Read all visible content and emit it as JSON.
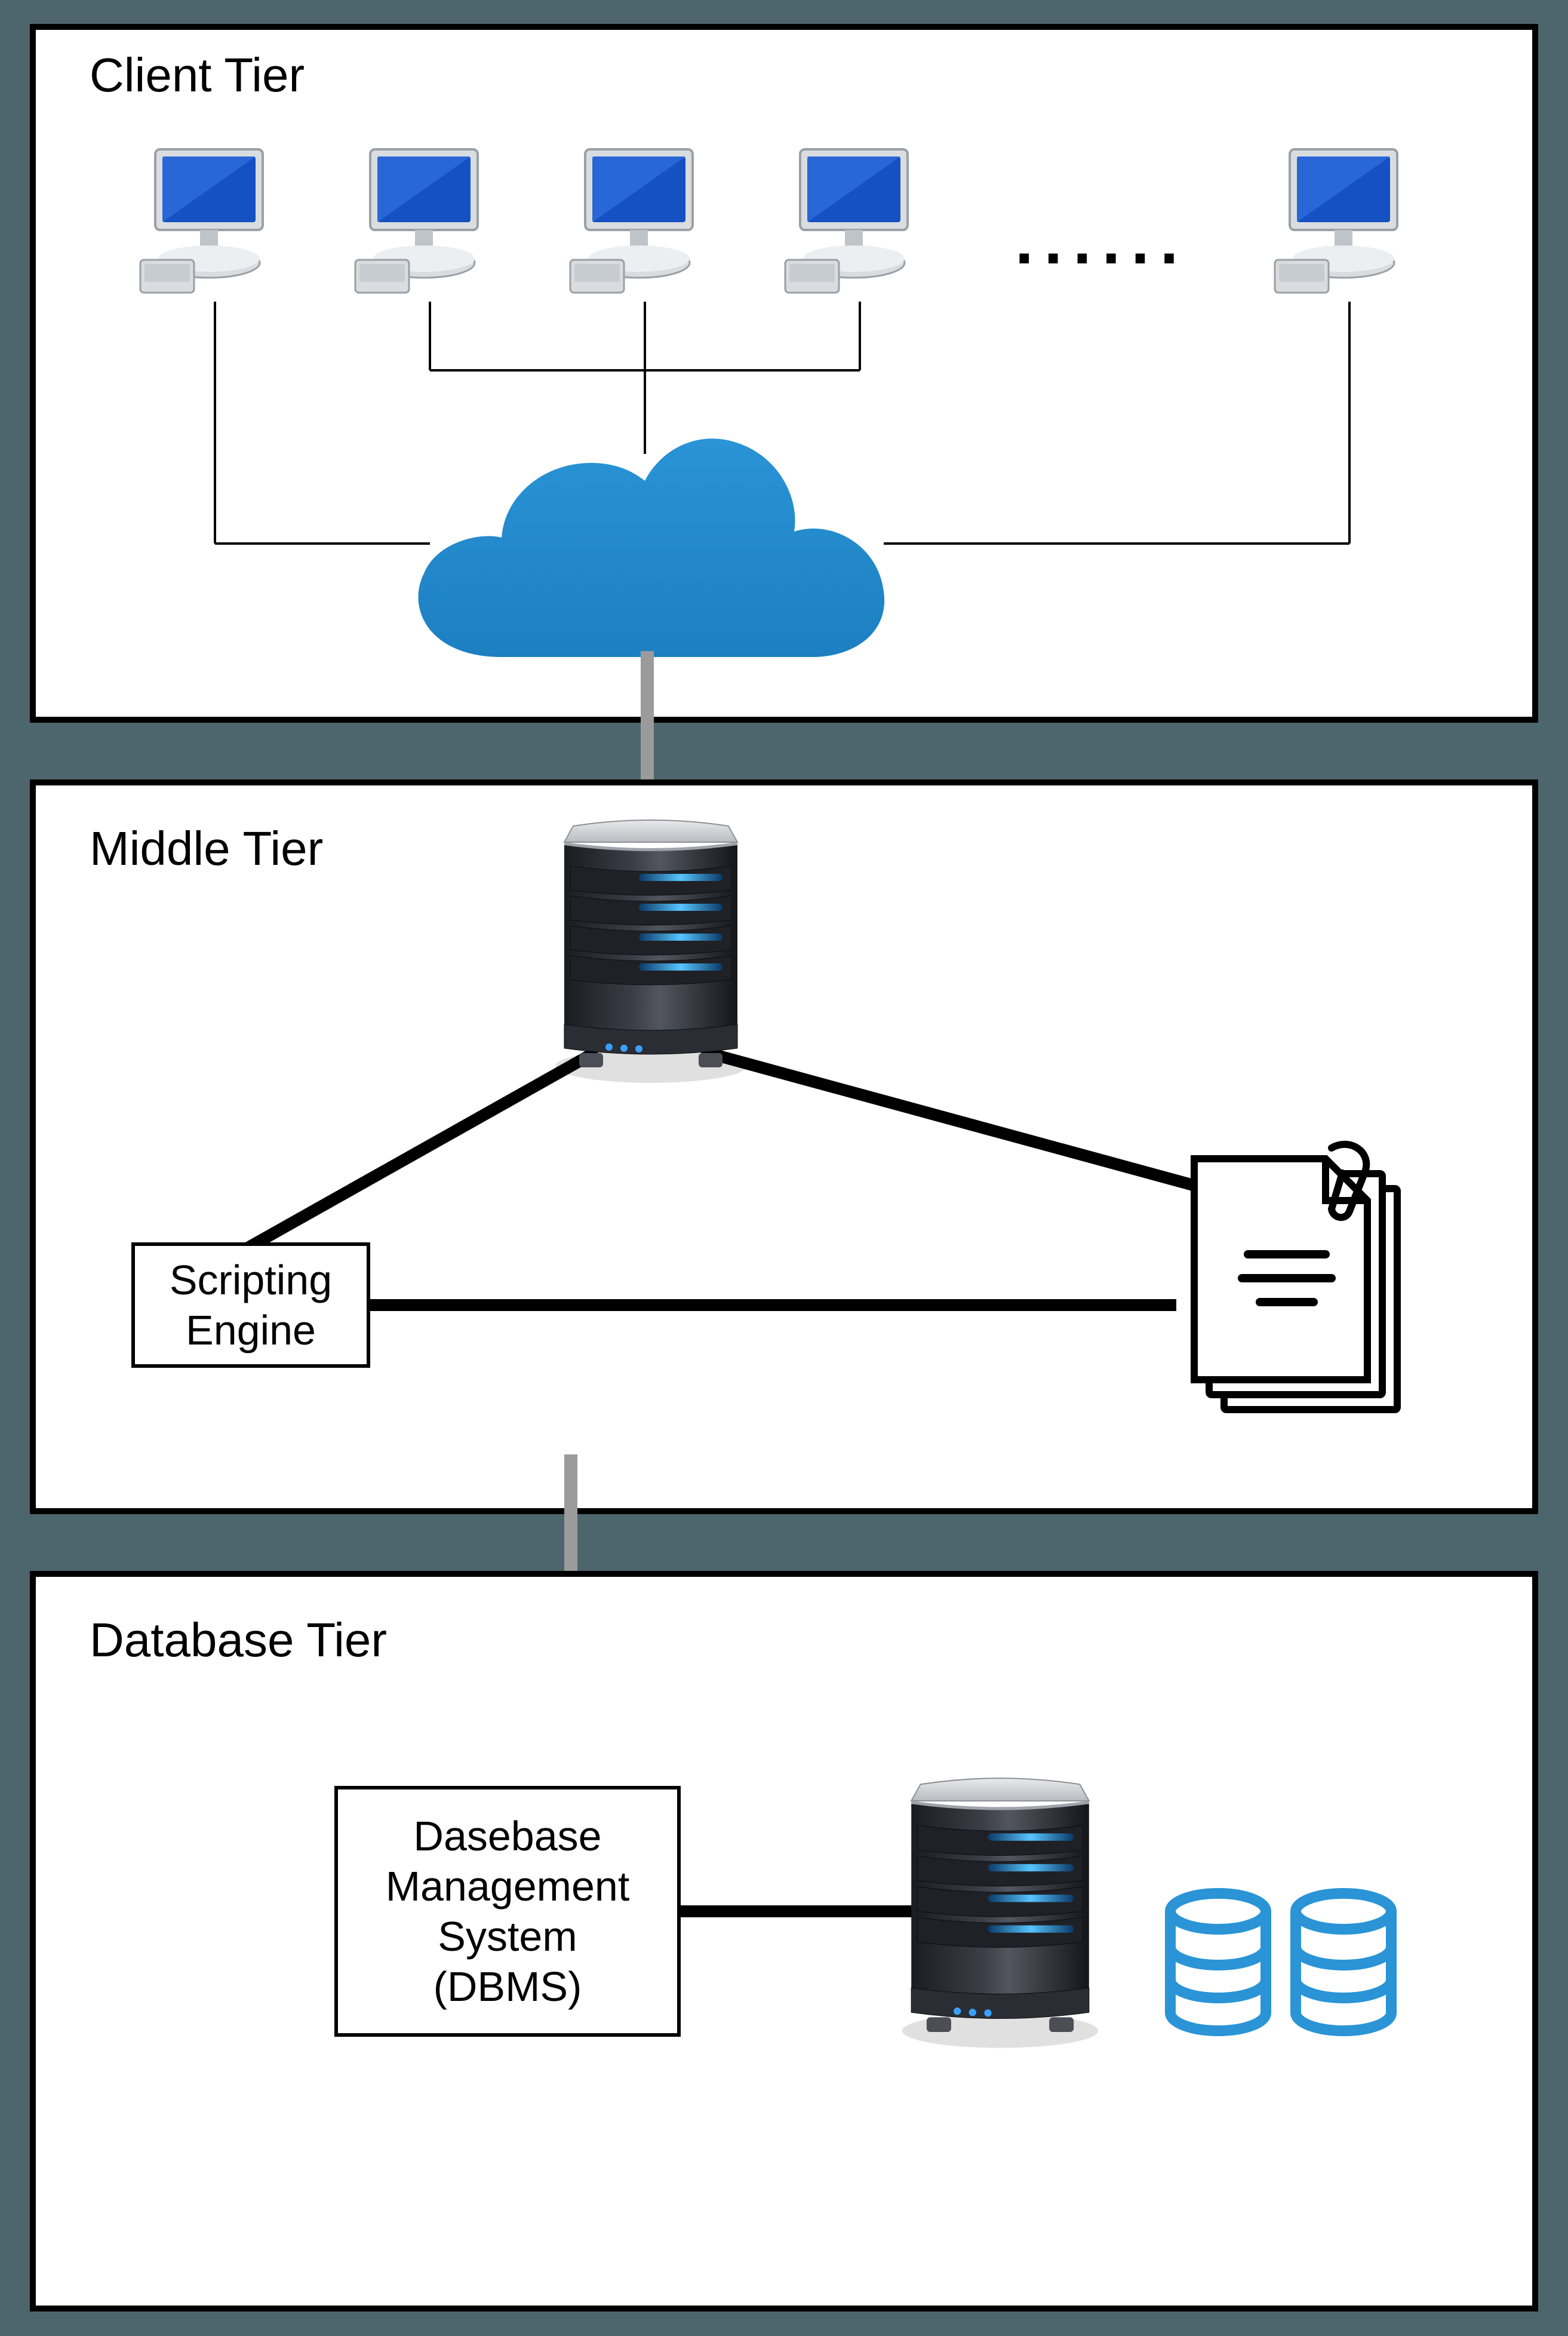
{
  "tiers": {
    "client": {
      "label": "Client Tier"
    },
    "middle": {
      "label": "Middle Tier"
    },
    "database": {
      "label": "Database Tier"
    }
  },
  "nodes": {
    "scripting_engine": {
      "line1": "Scripting",
      "line2": "Engine"
    },
    "dbms": {
      "line1": "Dasebase",
      "line2": "Management",
      "line3": "System",
      "line4": "(DBMS)"
    }
  },
  "ellipsis": "......",
  "colors": {
    "cloud": "#1c7fc1",
    "cloud_light": "#2a94d6",
    "monitor": "#1551c2",
    "monitor_frame": "#d9dde0",
    "server_dark": "#2a2c33",
    "server_light": "#4b4e57",
    "server_led": "#3aa0ff",
    "db_cylinder": "#2a94d6",
    "connector": "#9b9b9b"
  }
}
